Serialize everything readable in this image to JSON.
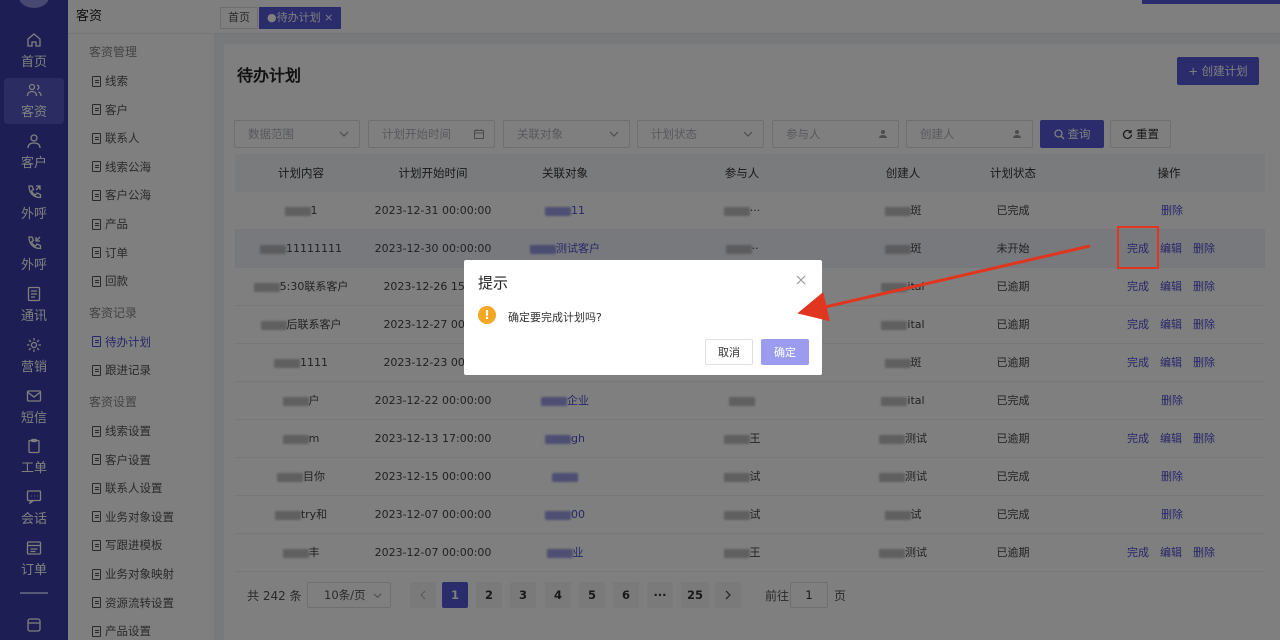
{
  "rail": {
    "items": [
      {
        "label": "首页",
        "icon": "home-icon"
      },
      {
        "label": "客资",
        "icon": "users-icon"
      },
      {
        "label": "客户",
        "icon": "user-icon"
      },
      {
        "label": "外呼",
        "icon": "phone-out-icon"
      },
      {
        "label": "外呼",
        "icon": "phone-in-icon"
      },
      {
        "label": "通讯",
        "icon": "contact-book-icon"
      },
      {
        "label": "营销",
        "icon": "gear-icon"
      },
      {
        "label": "短信",
        "icon": "message-icon"
      },
      {
        "label": "工单",
        "icon": "clipboard-icon"
      },
      {
        "label": "会话",
        "icon": "chat-icon"
      },
      {
        "label": "订单",
        "icon": "order-icon"
      }
    ],
    "active_index": 1
  },
  "sidebar": {
    "title": "客资",
    "groups": [
      {
        "label": "客资管理",
        "items": [
          "线索",
          "客户",
          "联系人",
          "线索公海",
          "客户公海",
          "产品",
          "订单",
          "回款"
        ]
      },
      {
        "label": "客资记录",
        "items": [
          "待办计划",
          "跟进记录"
        ]
      },
      {
        "label": "客资设置",
        "items": [
          "线索设置",
          "客户设置",
          "联系人设置",
          "业务对象设置",
          "写跟进模板",
          "业务对象映射",
          "资源流转设置",
          "产品设置"
        ]
      }
    ],
    "active_item": "待办计划"
  },
  "tabs": {
    "home": "首页",
    "active": "●待办计划 ×"
  },
  "page": {
    "title": "待办计划",
    "create_button": "+ 创建计划"
  },
  "filters": {
    "data_range": "数据范围",
    "start_time": "计划开始时间",
    "related_object": "关联对象",
    "plan_status": "计划状态",
    "participant": "参与人",
    "creator": "创建人",
    "query_button": "查询",
    "reset_button": "重置"
  },
  "table": {
    "headers": [
      "计划内容",
      "计划开始时间",
      "关联对象",
      "参与人",
      "创建人",
      "计划状态",
      "操作"
    ],
    "rows": [
      {
        "content": "1",
        "time": "2023-12-31 00:00:00",
        "related": "11",
        "participant": "···",
        "creator": "斑",
        "status": "已完成",
        "actions": [
          "删除"
        ]
      },
      {
        "content": "11111111",
        "time": "2023-12-30 00:00:00",
        "related": "测试客户",
        "participant": "··",
        "creator": "斑",
        "status": "未开始",
        "actions": [
          "完成",
          "编辑",
          "删除"
        ]
      },
      {
        "content": "5:30联系客户",
        "time": "2023-12-26 15:00",
        "related": "",
        "participant": "",
        "creator": "ital",
        "status": "已逾期",
        "actions": [
          "完成",
          "编辑",
          "删除"
        ]
      },
      {
        "content": "后联系客户",
        "time": "2023-12-27 00:00",
        "related": "",
        "participant": "",
        "creator": "ital",
        "status": "已逾期",
        "actions": [
          "完成",
          "编辑",
          "删除"
        ]
      },
      {
        "content": "1111",
        "time": "2023-12-23 00:00",
        "related": "",
        "participant": "",
        "creator": "斑",
        "status": "已逾期",
        "actions": [
          "完成",
          "编辑",
          "删除"
        ]
      },
      {
        "content": "户",
        "time": "2023-12-22 00:00:00",
        "related": "企业",
        "participant": "",
        "creator": "ital",
        "status": "已完成",
        "actions": [
          "删除"
        ]
      },
      {
        "content": "m",
        "time": "2023-12-13 17:00:00",
        "related": "gh",
        "participant": "王",
        "creator": "测试",
        "status": "已逾期",
        "actions": [
          "完成",
          "编辑",
          "删除"
        ]
      },
      {
        "content": "目你",
        "time": "2023-12-15 00:00:00",
        "related": "",
        "participant": "试",
        "creator": "测试",
        "status": "已完成",
        "actions": [
          "删除"
        ]
      },
      {
        "content": "try和",
        "time": "2023-12-07 00:00:00",
        "related": "00",
        "participant": "试",
        "creator": "试",
        "status": "已完成",
        "actions": [
          "删除"
        ]
      },
      {
        "content": "丰",
        "time": "2023-12-07 00:00:00",
        "related": "业",
        "participant": "王",
        "creator": "测试",
        "status": "已逾期",
        "actions": [
          "完成",
          "编辑",
          "删除"
        ]
      }
    ]
  },
  "pagination": {
    "total": "共 242 条",
    "page_size": "10条/页",
    "pages": [
      "1",
      "2",
      "3",
      "4",
      "5",
      "6",
      "···",
      "25"
    ],
    "current": "1",
    "goto_label": "前往",
    "goto_value": "1",
    "goto_unit": "页"
  },
  "dialog": {
    "title": "提示",
    "message": "确定要完成计划吗?",
    "cancel": "取消",
    "confirm": "确定"
  },
  "colors": {
    "primary": "#5558d6",
    "rail": "#3b3fa8",
    "annotation": "#e0351f"
  }
}
